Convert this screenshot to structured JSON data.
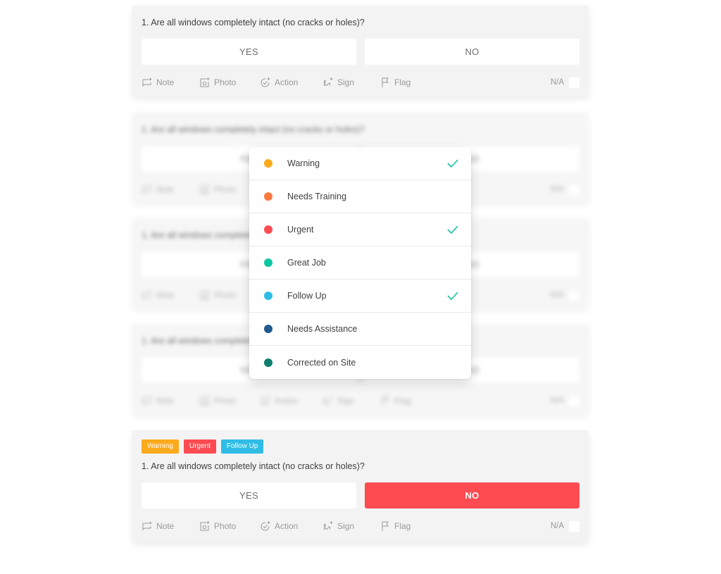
{
  "question_text": "1. Are all windows completely intact (no cracks or holes)?",
  "answers": {
    "yes": "YES",
    "no": "NO"
  },
  "toolbar": {
    "note": "Note",
    "photo": "Photo",
    "action": "Action",
    "sign": "Sign",
    "flag": "Flag",
    "na": "N/A"
  },
  "dropdown": {
    "items": [
      {
        "label": "Warning",
        "color": "#fbaa1c",
        "checked": true
      },
      {
        "label": "Needs Training",
        "color": "#fd7a3d",
        "checked": false
      },
      {
        "label": "Urgent",
        "color": "#fd4b51",
        "checked": true
      },
      {
        "label": "Great Job",
        "color": "#0ec6a1",
        "checked": false
      },
      {
        "label": "Follow Up",
        "color": "#2fbde6",
        "checked": true
      },
      {
        "label": "Needs Assistance",
        "color": "#1f5b8c",
        "checked": false
      },
      {
        "label": "Corrected on Site",
        "color": "#0e7e6e",
        "checked": false
      }
    ],
    "check_color": "#16c3a3"
  },
  "bottom_card": {
    "tags": [
      {
        "label": "Warning",
        "color": "#fbaa1c"
      },
      {
        "label": "Urgent",
        "color": "#fd4b51"
      },
      {
        "label": "Follow Up",
        "color": "#2fbde6"
      }
    ],
    "selected_answer": "NO",
    "selected_color": "#fd4b51"
  }
}
